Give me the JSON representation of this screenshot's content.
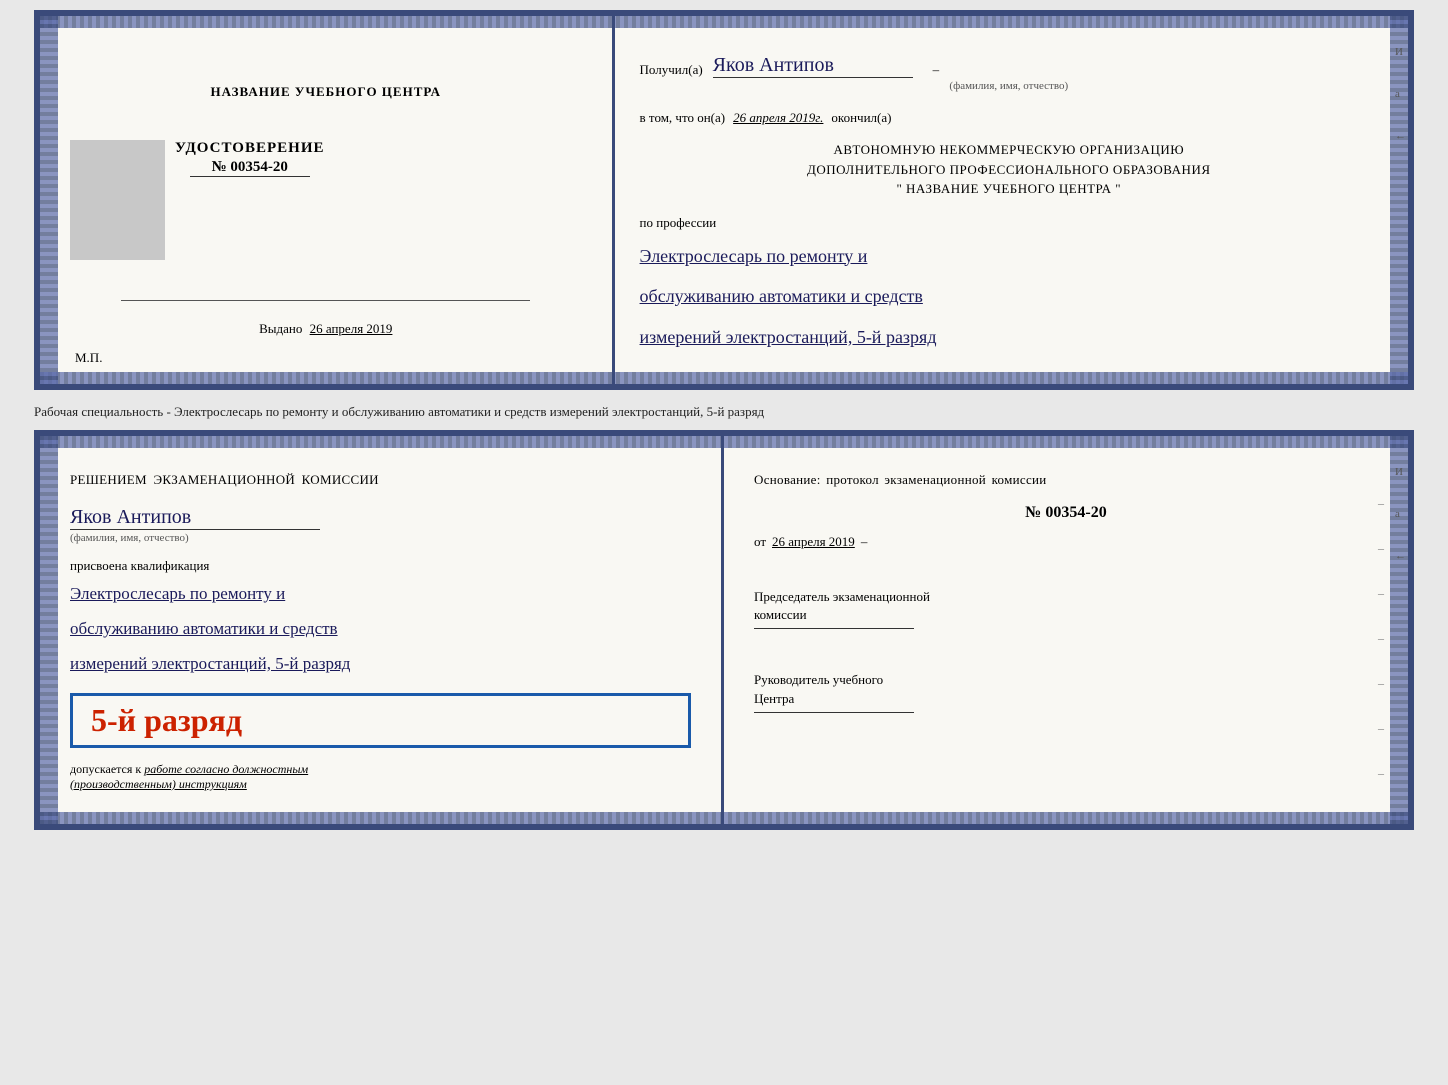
{
  "top_cert": {
    "left": {
      "school_name": "НАЗВАНИЕ УЧЕБНОГО ЦЕНТРА",
      "udost_title": "УДОСТОВЕРЕНИЕ",
      "udost_number": "№ 00354-20",
      "issued_label": "Выдано",
      "issued_date": "26 апреля 2019",
      "mp_label": "М.П."
    },
    "right": {
      "received_label": "Получил(а)",
      "recipient_name": "Яков Антипов",
      "fio_hint": "(фамилия, имя, отчество)",
      "vtom_label": "в том, что он(а)",
      "vtom_date": "26 апреля 2019г.",
      "vtom_ended": "окончил(а)",
      "org_line1": "АВТОНОМНУЮ НЕКОММЕРЧЕСКУЮ ОРГАНИЗАЦИЮ",
      "org_line2": "ДОПОЛНИТЕЛЬНОГО ПРОФЕССИОНАЛЬНОГО ОБРАЗОВАНИЯ",
      "org_line3": "\"  НАЗВАНИЕ УЧЕБНОГО ЦЕНТРА  \"",
      "prof_label": "по профессии",
      "prof_line1": "Электрослесарь по ремонту и",
      "prof_line2": "обслуживанию автоматики и средств",
      "prof_line3": "измерений электростанций, 5-й разряд"
    }
  },
  "between_label": "Рабочая специальность - Электрослесарь по ремонту и обслуживанию автоматики и средств измерений электростанций, 5-й разряд",
  "bottom_cert": {
    "left": {
      "decision_text": "Решением экзаменационной комиссии",
      "name": "Яков Антипов",
      "fio_hint": "(фамилия, имя, отчество)",
      "kvali_label": "присвоена квалификация",
      "kvali_line1": "Электрослесарь по ремонту и",
      "kvali_line2": "обслуживанию автоматики и средств",
      "kvali_line3": "измерений электростанций, 5-й разряд",
      "rank_badge": "5-й разряд",
      "допускается_label": "допускается к",
      "допускается_text": "работе согласно должностным",
      "допускается_text2": "(производственным) инструкциям"
    },
    "right": {
      "osnov_label": "Основание: протокол экзаменационной комиссии",
      "protocol_number": "№ 00354-20",
      "date_label": "от",
      "date_value": "26 апреля 2019",
      "chairman_label": "Председатель экзаменационной\nкомиссии",
      "head_label": "Руководитель учебного\nЦентра"
    }
  },
  "edge_marks": {
    "И": "И",
    "а": "а",
    "←": "←"
  }
}
